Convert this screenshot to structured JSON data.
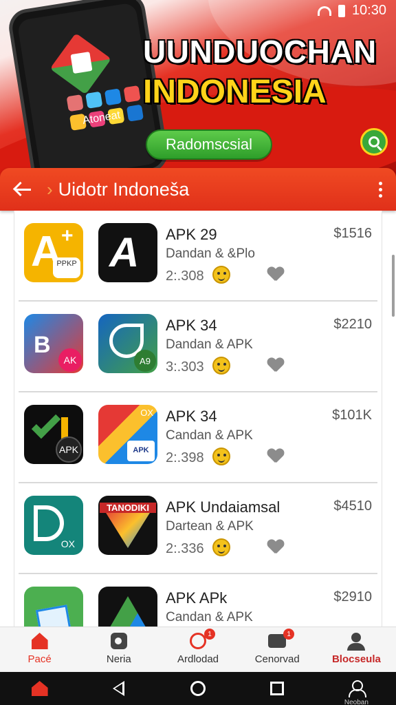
{
  "status_bar": {
    "time": "10:30"
  },
  "banner": {
    "headline_line1": "UUNDUOCHAN",
    "headline_line2": "INDONESIA",
    "cta_label": "Radomscsial",
    "phone_text": "Atoneat"
  },
  "app_bar": {
    "title": "Uidotr Indoneša"
  },
  "apps": [
    {
      "name": "APK 29",
      "subtitle": "Dandan & &Plo",
      "count": "2:.308",
      "price": "$1516",
      "icon1_text": "A",
      "icon1_caption": "PPKP",
      "icon2_text": "A"
    },
    {
      "name": "APK 34",
      "subtitle": "Dandan & APK",
      "count": "3:.303",
      "price": "$2210",
      "icon1_text": "B",
      "icon1_caption": "AK",
      "icon2_text": "A9"
    },
    {
      "name": "APK 34",
      "subtitle": "Candan & APK",
      "count": "2:.398",
      "price": "$101K",
      "icon1_text": "APK",
      "icon1_caption": "",
      "icon2_text": "OX",
      "icon2_caption": "APK"
    },
    {
      "name": "APK Undaiamsal",
      "subtitle": "Dartean & APK",
      "count": "2:.336",
      "price": "$4510",
      "icon1_text": "OX",
      "icon1_caption": "",
      "icon2_text": "TANODIKI"
    },
    {
      "name": "APK APk",
      "subtitle": "Candan & APK",
      "count": "",
      "price": "$2910",
      "icon1_text": "",
      "icon1_caption": "",
      "icon2_text": ""
    }
  ],
  "bottom_nav": [
    {
      "label": "Pacé",
      "icon": "home-icon",
      "badge": ""
    },
    {
      "label": "Neria",
      "icon": "media-icon",
      "badge": ""
    },
    {
      "label": "Ardlodad",
      "icon": "download-icon",
      "badge": "1"
    },
    {
      "label": "Cenorvad",
      "icon": "chat-icon",
      "badge": "1"
    },
    {
      "label": "Blocseula",
      "icon": "profile-icon",
      "badge": ""
    }
  ],
  "system_nav": {
    "profile_caption": "Neoban"
  },
  "colors": {
    "primary": "#E53224",
    "accent_green": "#3AA83A",
    "headline_yellow": "#FFD31A"
  }
}
